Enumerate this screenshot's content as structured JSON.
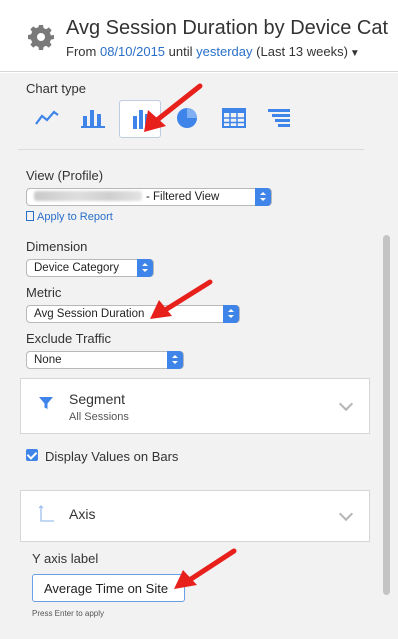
{
  "header": {
    "title": "Avg Session Duration by Device Cat",
    "from_label": "From",
    "from_date": "08/10/2015",
    "until_label": "until",
    "until_date": "yesterday",
    "range_note": "(Last 13 weeks)",
    "settings_icon": "gear-icon",
    "dropdown_icon": "caret-down-icon"
  },
  "chart_type": {
    "label": "Chart type",
    "options": [
      {
        "icon": "line-chart-icon"
      },
      {
        "icon": "bar-chart-icon"
      },
      {
        "icon": "column-chart-icon",
        "selected": true
      },
      {
        "icon": "pie-chart-icon"
      },
      {
        "icon": "table-icon"
      },
      {
        "icon": "funnel-icon"
      }
    ]
  },
  "view": {
    "label": "View (Profile)",
    "value_suffix": "- Filtered View",
    "apply_link": "Apply to Report"
  },
  "dimension": {
    "label": "Dimension",
    "value": "Device Category"
  },
  "metric": {
    "label": "Metric",
    "value": "Avg Session Duration"
  },
  "exclude_traffic": {
    "label": "Exclude Traffic",
    "value": "None"
  },
  "segment": {
    "title": "Segment",
    "subtitle": "All Sessions",
    "icon": "filter-icon"
  },
  "display_values": {
    "label": "Display Values on Bars",
    "checked": true
  },
  "axis": {
    "title": "Axis",
    "icon": "axis-icon",
    "y_label_caption": "Y axis label",
    "y_label_value": "Average Time on Site",
    "hint": "Press Enter to apply"
  },
  "colors": {
    "accent": "#3f84e8",
    "link": "#2a6fc9",
    "annotation": "#e8201c"
  }
}
